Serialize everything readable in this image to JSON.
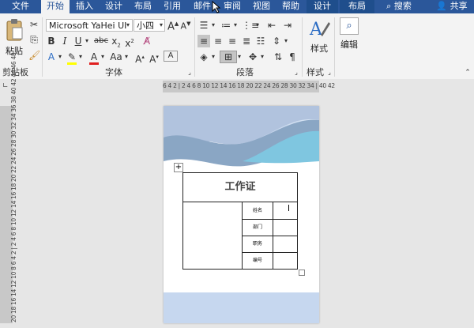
{
  "tabs": [
    {
      "label": "文件"
    },
    {
      "label": "开始"
    },
    {
      "label": "插入"
    },
    {
      "label": "设计"
    },
    {
      "label": "布局"
    },
    {
      "label": "引用"
    },
    {
      "label": "邮件"
    },
    {
      "label": "审阅"
    },
    {
      "label": "视图"
    },
    {
      "label": "帮助"
    },
    {
      "label": "设计"
    },
    {
      "label": "布局"
    }
  ],
  "search_label": "搜索",
  "share_label": "共享",
  "ribbon": {
    "clipboard": {
      "paste_label": "粘贴",
      "group_label": "剪贴板"
    },
    "font": {
      "font_name": "Microsoft YaHei UI",
      "font_size": "小四",
      "group_label": "字体",
      "aa_label": "Aa"
    },
    "paragraph": {
      "group_label": "段落"
    },
    "styles": {
      "styles_label": "样式",
      "group_label": "样式"
    },
    "editing": {
      "editing_label": "编辑"
    }
  },
  "ruler": {
    "horizontal": "6 4 2 | 2 4 6 8 10 12 14 16 18 20 22 24 26 28 30 32 34 | 40 42",
    "vertical": "20 18 16 14 12 10 8 6 4 2 | 2 4 6 8 10 12 14 16 18 20 22 24 26 28 30 32 34 36 38 40 42 44 46 48"
  },
  "document": {
    "card_title": "工作证",
    "fields": [
      {
        "label": "姓名"
      },
      {
        "label": "部门"
      },
      {
        "label": "职务"
      },
      {
        "label": "编号"
      }
    ]
  },
  "colors": {
    "ribbon_tab_bar": "#2b579a",
    "ribbon_bg": "#f3f3f3",
    "workspace_bg": "#e6e6e6",
    "wave_dark": "#8aa6c4",
    "wave_light": "#7fc6e0",
    "footer_band": "#c6d7ef"
  }
}
